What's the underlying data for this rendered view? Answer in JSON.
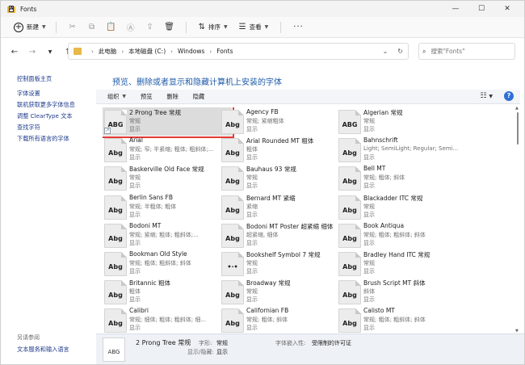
{
  "window": {
    "title": "Fonts",
    "minimize": "—",
    "maximize": "☐",
    "close": "✕"
  },
  "commandbar": {
    "new_label": "新建",
    "sort_label": "排序",
    "view_label": "查看",
    "more": "···"
  },
  "address": {
    "crumbs": [
      "此电脑",
      "本地磁盘 (C:)",
      "Windows",
      "Fonts"
    ],
    "search_placeholder": "搜索\"Fonts\""
  },
  "leftpane": {
    "links": [
      "控制面板主页",
      "字体设置",
      "联机获取更多字体信息",
      "调整 ClearType 文本",
      "查找字符",
      "下载所有语言的字体"
    ],
    "see_also_label": "另请参阅",
    "see_also_links": [
      "文本服务和输入语言"
    ]
  },
  "main": {
    "heading": "预览、删除或者显示和隐藏计算机上安装的字体",
    "toolbar": [
      "组织",
      "预览",
      "删除",
      "隐藏"
    ],
    "help": "?"
  },
  "fonts": [
    {
      "name": "2 Prong Tree 常规",
      "sub": "常规",
      "show": "显示",
      "sample": "ABG",
      "shortcut": true,
      "selected": true
    },
    {
      "name": "Agency FB",
      "sub": "常规; 紧缩粗体",
      "show": "显示",
      "sample": "Abg"
    },
    {
      "name": "Algerian 常规",
      "sub": "常规",
      "show": "显示",
      "sample": "ABG"
    },
    {
      "name": "Arial",
      "sub": "常规; 窄; 半紧缩; 粗体; 粗斜体;...",
      "show": "显示",
      "sample": "Abg"
    },
    {
      "name": "Arial Rounded MT 粗体",
      "sub": "粗体",
      "show": "显示",
      "sample": "Abg"
    },
    {
      "name": "Bahnschrift",
      "sub": "Light; SemiLight; Regular; Semi...",
      "show": "显示",
      "sample": "Abg"
    },
    {
      "name": "Baskerville Old Face 常规",
      "sub": "常规",
      "show": "显示",
      "sample": "Abg"
    },
    {
      "name": "Bauhaus 93 常规",
      "sub": "常规",
      "show": "显示",
      "sample": "Abg"
    },
    {
      "name": "Bell MT",
      "sub": "常规; 粗体; 斜体",
      "show": "显示",
      "sample": "Abg"
    },
    {
      "name": "Berlin Sans FB",
      "sub": "常规; 半粗体; 粗体",
      "show": "显示",
      "sample": "Abg"
    },
    {
      "name": "Bernard MT 紧缩",
      "sub": "紧缩",
      "show": "显示",
      "sample": "Abg"
    },
    {
      "name": "Blackadder ITC 常规",
      "sub": "常规",
      "show": "显示",
      "sample": "Abg"
    },
    {
      "name": "Bodoni MT",
      "sub": "常规; 紧缩; 粗体; 粗斜体;...",
      "show": "显示",
      "sample": "Abg"
    },
    {
      "name": "Bodoni MT Poster 超紧缩 细体",
      "sub": "超紧缩, 细体",
      "show": "显示",
      "sample": "Abg"
    },
    {
      "name": "Book Antiqua",
      "sub": "常规; 粗体; 粗斜体; 斜体",
      "show": "显示",
      "sample": "Abg"
    },
    {
      "name": "Bookman Old Style",
      "sub": "常规; 粗体; 粗斜体; 斜体",
      "show": "显示",
      "sample": "Abg"
    },
    {
      "name": "Bookshelf Symbol 7 常规",
      "sub": "常规",
      "show": "显示",
      "sample": "•·•"
    },
    {
      "name": "Bradley Hand ITC 常规",
      "sub": "常规",
      "show": "显示",
      "sample": "Abg"
    },
    {
      "name": "Britannic 粗体",
      "sub": "粗体",
      "show": "显示",
      "sample": "Abg"
    },
    {
      "name": "Broadway 常规",
      "sub": "常规",
      "show": "显示",
      "sample": "Abg"
    },
    {
      "name": "Brush Script MT 斜体",
      "sub": "斜体",
      "show": "显示",
      "sample": "Abg"
    },
    {
      "name": "Calibri",
      "sub": "常规; 细体; 粗体; 粗斜体; 细...",
      "show": "显示",
      "sample": "Abg"
    },
    {
      "name": "Californian FB",
      "sub": "常规; 粗体; 斜体",
      "show": "显示",
      "sample": "Abg"
    },
    {
      "name": "Calisto MT",
      "sub": "常规; 粗体; 粗斜体; 斜体",
      "show": "显示",
      "sample": "Abg"
    }
  ],
  "details": {
    "name": "2 Prong Tree 常规",
    "sample": "ABG",
    "style_label": "字形:",
    "style_value": "常规",
    "showhide_label": "显示/隐藏:",
    "showhide_value": "显示",
    "embed_label": "字体嵌入性:",
    "embed_value": "受限制的许可证"
  }
}
